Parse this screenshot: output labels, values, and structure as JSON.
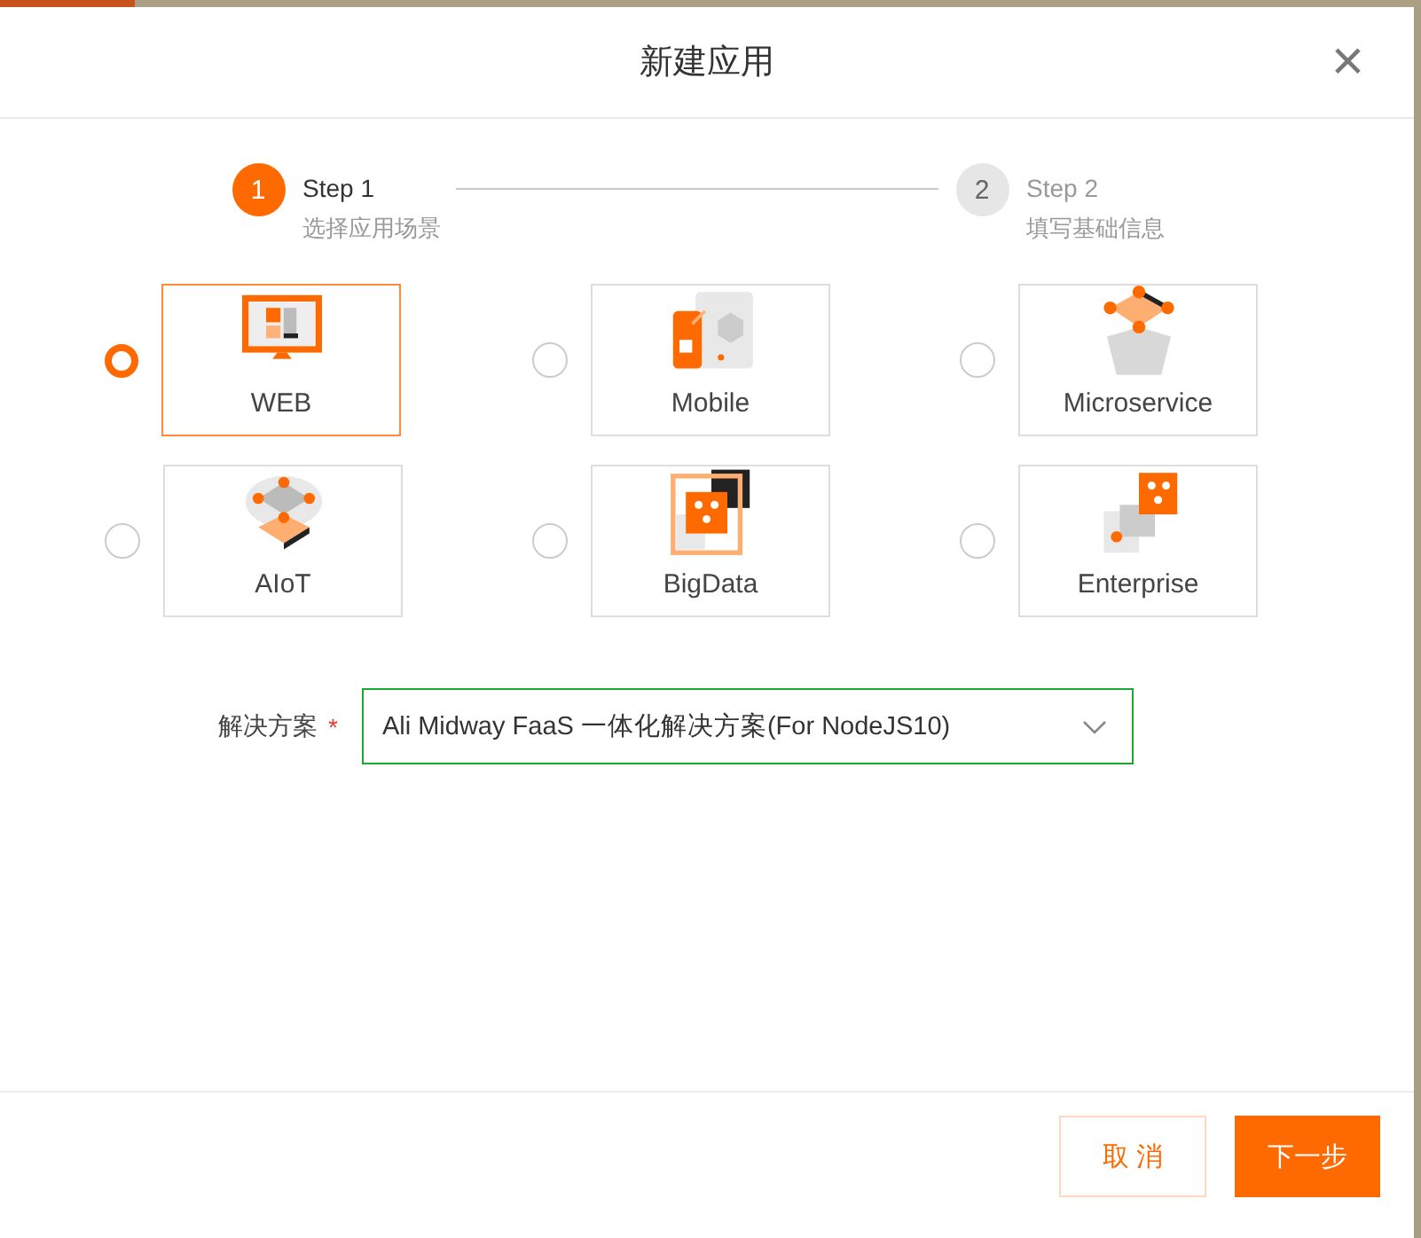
{
  "loading_bar": {
    "level": 0.095
  },
  "dialog": {
    "title": "新建应用",
    "close": "×"
  },
  "steps": [
    {
      "number": "1",
      "title": "Step 1",
      "description": "选择应用场景",
      "active": true
    },
    {
      "number": "2",
      "title": "Step 2",
      "description": "填写基础信息",
      "active": false
    }
  ],
  "scenarios": [
    {
      "kind": "web",
      "label": "WEB",
      "selected": true
    },
    {
      "kind": "mobile",
      "label": "Mobile",
      "selected": false
    },
    {
      "kind": "microservice",
      "label": "Microservice",
      "selected": false
    },
    {
      "kind": "aiot",
      "label": "AIoT",
      "selected": false
    },
    {
      "kind": "bigdata",
      "label": "BigData",
      "selected": false
    },
    {
      "kind": "enterprise",
      "label": "Enterprise",
      "selected": false
    }
  ],
  "solution": {
    "label": "解决方案",
    "required_mark": "*",
    "value": "Ali Midway FaaS 一体化解决方案(For NodeJS10)"
  },
  "buttons": [
    {
      "kind": "secondary",
      "label": "取 消"
    },
    {
      "kind": "primary",
      "label": "下一步"
    }
  ]
}
